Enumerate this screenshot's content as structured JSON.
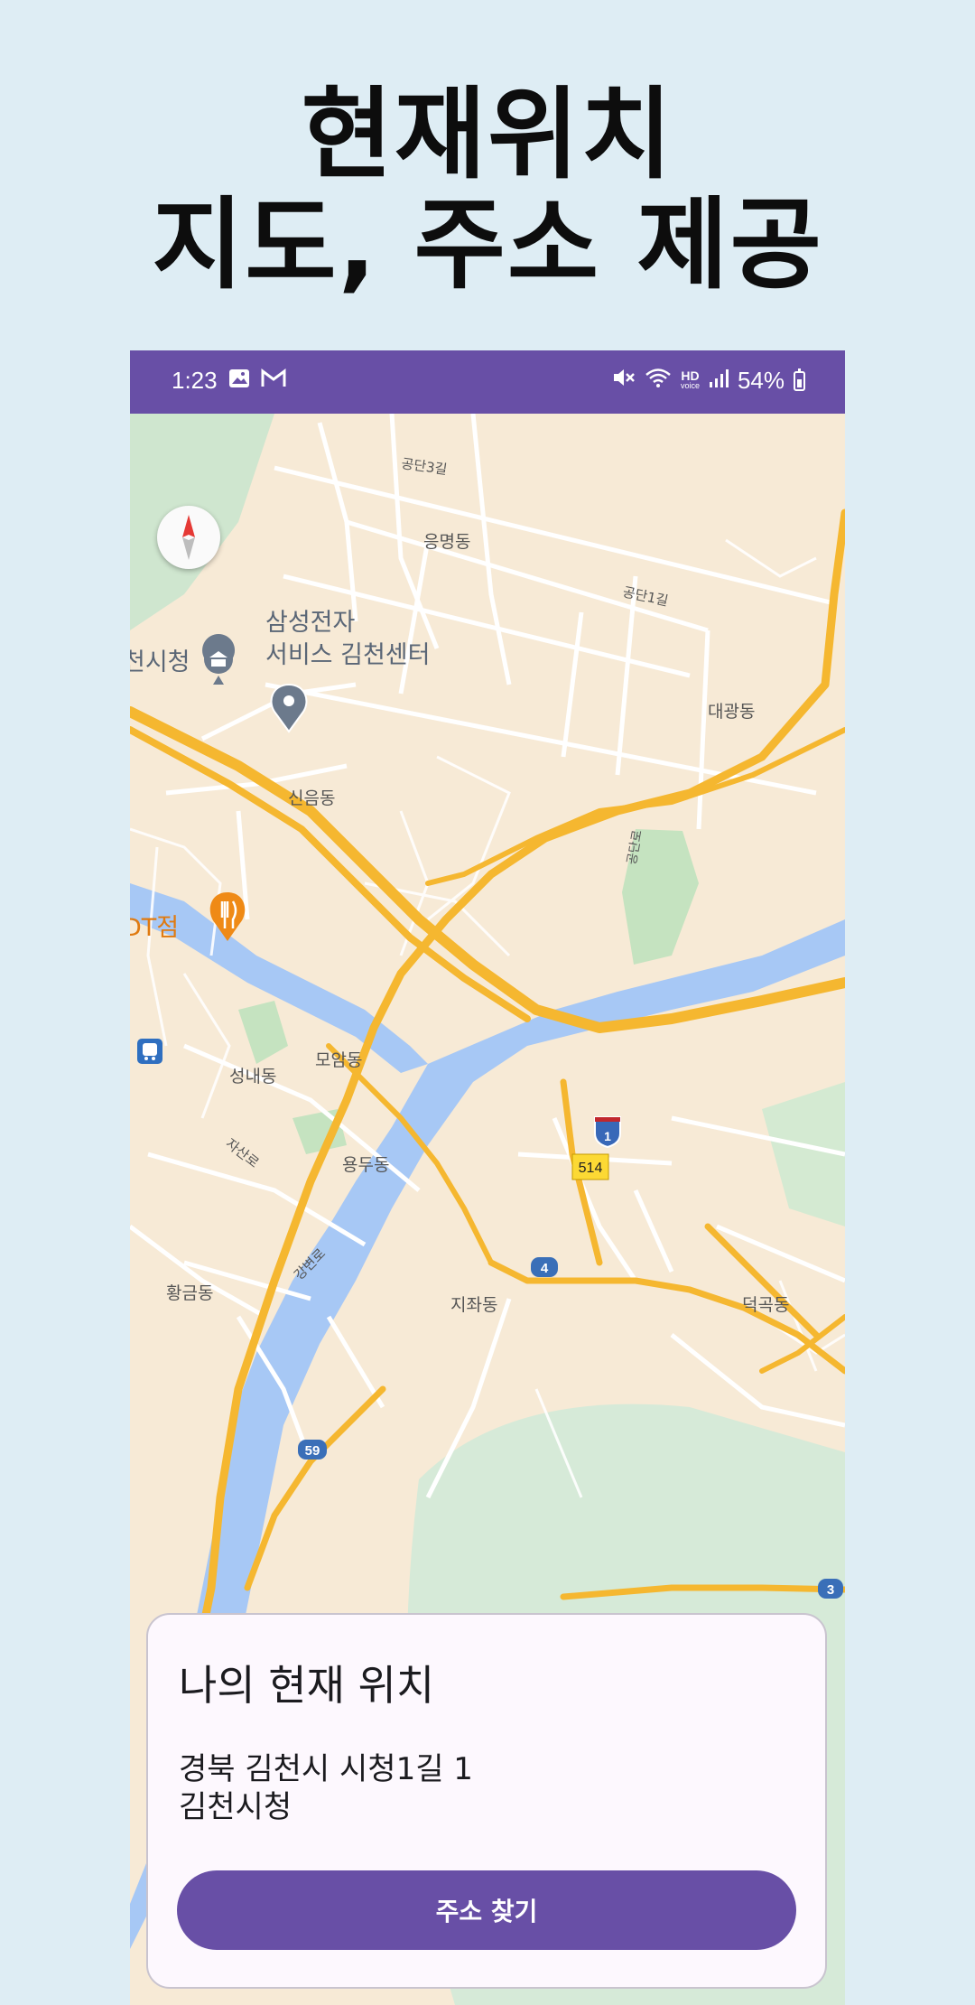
{
  "headline": {
    "line1": "현재위치",
    "line2": "지도, 주소 제공"
  },
  "status_bar": {
    "time": "1:23",
    "network_label": "HD",
    "network_sublabel": "voice",
    "battery": "54%",
    "icons": [
      "image-icon",
      "gmail-icon",
      "mute-icon",
      "wifi-icon",
      "signal-icon",
      "battery-icon"
    ]
  },
  "map": {
    "labels": {
      "gongdan3gil": "공단3길",
      "eungmyeong": "응명동",
      "gongdan1gil": "공단1길",
      "samsung_line1": "삼성전자",
      "samsung_line2": "서비스 김천센터",
      "cityhall": "천시청",
      "daegwang": "대광동",
      "sineum": "신음동",
      "gongdanro": "공단로",
      "dt_store": "DT점",
      "seongnae": "성내동",
      "moam": "모암동",
      "jaseonro": "자산로",
      "yongdu": "용두동",
      "hwanggeum": "황금동",
      "gangbyeonro": "강변로",
      "jijwa": "지좌동",
      "deokgok": "덕곡동"
    },
    "route_shields": {
      "interstate": "1",
      "r514": "514",
      "r4": "4",
      "r59": "59",
      "r3": "3"
    },
    "colors": {
      "land": "#f7ead6",
      "water": "#a7c8f5",
      "park": "#c5e3c0",
      "highway": "#f5b730",
      "road": "#ffffff"
    }
  },
  "card": {
    "title": "나의 현재 위치",
    "address_line1": "경북 김천시 시청1길 1",
    "address_line2": "김천시청",
    "button_label": "주소 찾기"
  },
  "accent_color": "#684fa6"
}
